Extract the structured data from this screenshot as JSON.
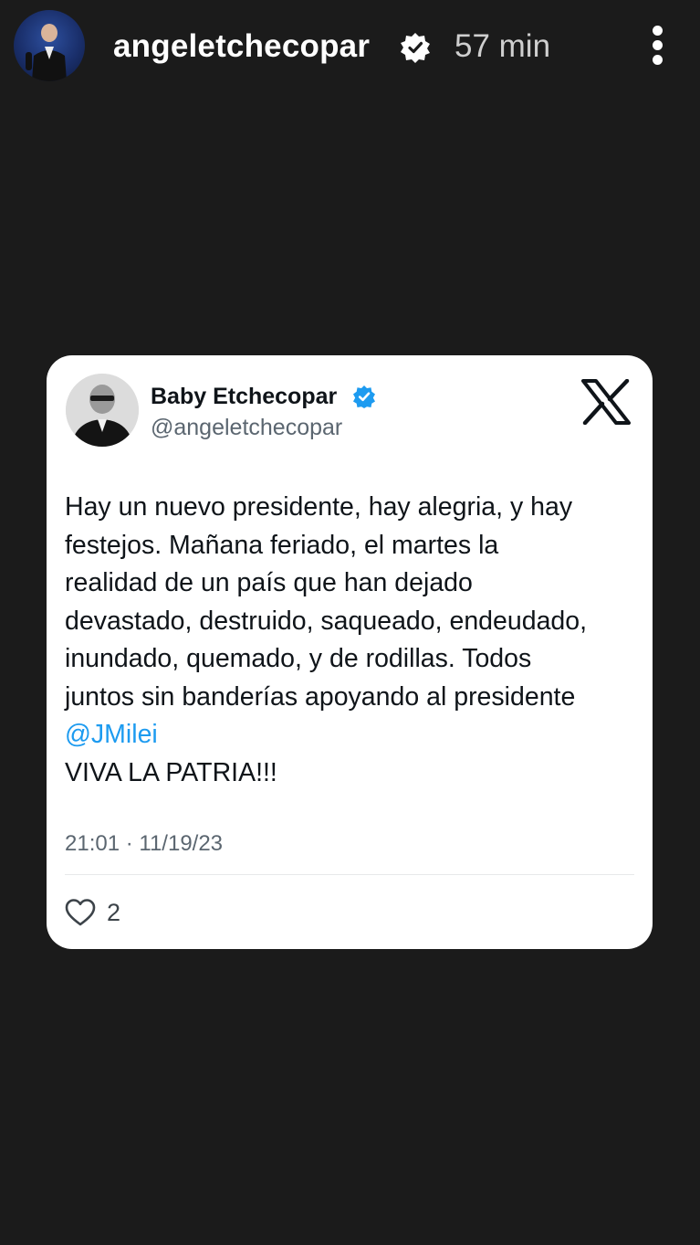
{
  "story": {
    "username": "angeletchecopar",
    "time": "57 min",
    "icons": {
      "verified": "verified-badge-icon",
      "menu": "more-vertical-icon"
    }
  },
  "tweet": {
    "display_name": "Baby Etchecopar",
    "handle": "@angeletchecopar",
    "body_lines": [
      "Hay un nuevo presidente, hay alegria, y hay",
      "festejos. Mañana feriado, el martes la",
      "realidad de un país que han dejado",
      "devastado, destruido, saqueado, endeudado,",
      "inundado, quemado, y de rodillas. Todos",
      "juntos sin banderías apoyando al presidente"
    ],
    "mention": "@JMilei",
    "closing_line": "VIVA LA PATRIA!!!",
    "timestamp": "21:01 · 11/19/23",
    "like_count": "2",
    "icons": {
      "verified": "blue-verified-icon",
      "brand": "x-logo-icon",
      "like": "heart-icon"
    }
  },
  "colors": {
    "background": "#1b1b1b",
    "card": "#ffffff",
    "mention": "#1d9bf0",
    "verified_blue": "#1d9bf0",
    "text": "#0f1419",
    "muted": "#5b6670"
  }
}
